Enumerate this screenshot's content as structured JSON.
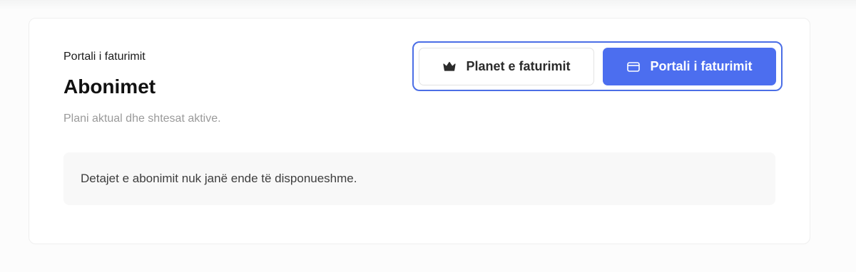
{
  "header": {
    "breadcrumb": "Portali i faturimit",
    "title": "Abonimet",
    "subtitle": "Plani aktual dhe shtesat aktive."
  },
  "actions": {
    "plans_label": "Planet e faturimit",
    "plans_icon": "crown-icon",
    "portal_label": "Portali i faturimit",
    "portal_icon": "credit-card-icon"
  },
  "notice": {
    "text": "Detajet e abonimit nuk janë ende të disponueshme."
  },
  "colors": {
    "accent": "#4c6eef",
    "focus_ring": "#4b6ee6",
    "notice_bg": "#f8f8f8"
  }
}
